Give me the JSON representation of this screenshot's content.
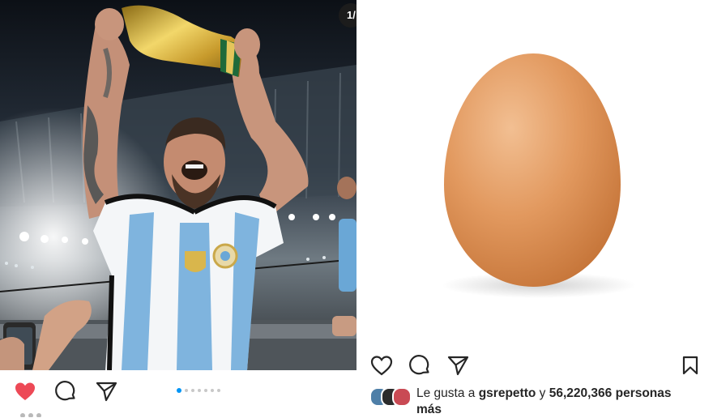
{
  "left_post": {
    "image": "messi-holding-world-cup-trophy-photo",
    "carousel_counter": "1/",
    "carousel": {
      "total": 7,
      "active_index": 0
    },
    "actions": {
      "like_icon": "heart-filled-icon",
      "liked": true,
      "comment_icon": "comment-icon",
      "share_icon": "send-icon"
    },
    "colors": {
      "like_red": "#ed4956",
      "dot_active": "#0095f6"
    }
  },
  "right_post": {
    "image": "brown-egg-photo",
    "actions": {
      "like_icon": "heart-outline-icon",
      "comment_icon": "comment-icon",
      "share_icon": "send-icon",
      "save_icon": "bookmark-icon"
    },
    "likes": {
      "prefix": "Le gusta a",
      "user": "gsrepetto",
      "connector": "y",
      "count": "56,220,366 personas",
      "suffix": "más"
    }
  }
}
